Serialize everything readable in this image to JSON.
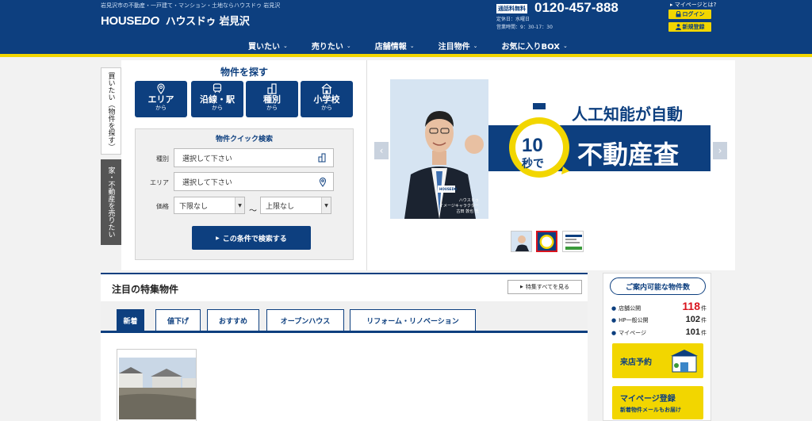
{
  "header": {
    "tagline": "岩見沢市の不動産・一戸建て・マンション・土地ならハウスドゥ 岩見沢",
    "logo_main": "HOUSE",
    "logo_do": "DO",
    "logo_kana": "ハウスドゥ 岩見沢",
    "free_call": "通話料無料",
    "phone": "0120-457-888",
    "closed": "定休日：水曜日",
    "hours": "営業時間：9：30-17：30",
    "mypage_question": "マイページとは?",
    "login": "ログイン",
    "signup": "新規登録",
    "nav": [
      {
        "label": "買いたい"
      },
      {
        "label": "売りたい"
      },
      {
        "label": "店舗情報"
      },
      {
        "label": "注目物件"
      },
      {
        "label": "お気に入りBOX"
      }
    ]
  },
  "side_tabs": {
    "buy": "買いたい（物件を探す）",
    "sell": "家・不動産を売りたい"
  },
  "search": {
    "title": "物件を探す",
    "buttons": [
      {
        "label": "エリア",
        "sub": "から"
      },
      {
        "label": "沿線・駅",
        "sub": "から"
      },
      {
        "label": "種別",
        "sub": "から"
      },
      {
        "label": "小学校",
        "sub": "から"
      }
    ],
    "quick_title": "物件クイック検索",
    "type_label": "種別",
    "type_value": "選択して下さい",
    "area_label": "エリア",
    "area_value": "選択して下さい",
    "price_label": "価格",
    "price_min": "下限なし",
    "tilde": "～",
    "price_max": "上限なし",
    "submit": "この条件で検索する"
  },
  "hero": {
    "headline": "人工知能が自動",
    "big": "不動産査",
    "num": "10",
    "num_sub": "秒で",
    "logo_badge": "HOUSEDO",
    "caption_1": "ハウスドゥ",
    "caption_2": "イメージキャラクター",
    "caption_3": "古田 敦也 氏"
  },
  "featured": {
    "title": "注目の特集物件",
    "see_all": "特集すべてを見る",
    "tabs": [
      {
        "label": "新着"
      },
      {
        "label": "値下げ"
      },
      {
        "label": "おすすめ"
      },
      {
        "label": "オープンハウス"
      },
      {
        "label": "リフォーム・リノベーション"
      }
    ]
  },
  "sidebar": {
    "title": "ご案内可能な物件数",
    "rows": [
      {
        "name": "店舗公開",
        "num": "118",
        "unit": "件"
      },
      {
        "name": "HP一般公開",
        "num": "102",
        "unit": "件"
      },
      {
        "name": "マイページ",
        "num": "101",
        "unit": "件"
      }
    ],
    "visit": "来店予約",
    "mypage": "マイページ登録",
    "mypage_sub": "新着物件メールもお届け"
  },
  "colors": {
    "brand": "#0d3f7f",
    "accent": "#f2d600",
    "highlight": "#d9141e"
  }
}
